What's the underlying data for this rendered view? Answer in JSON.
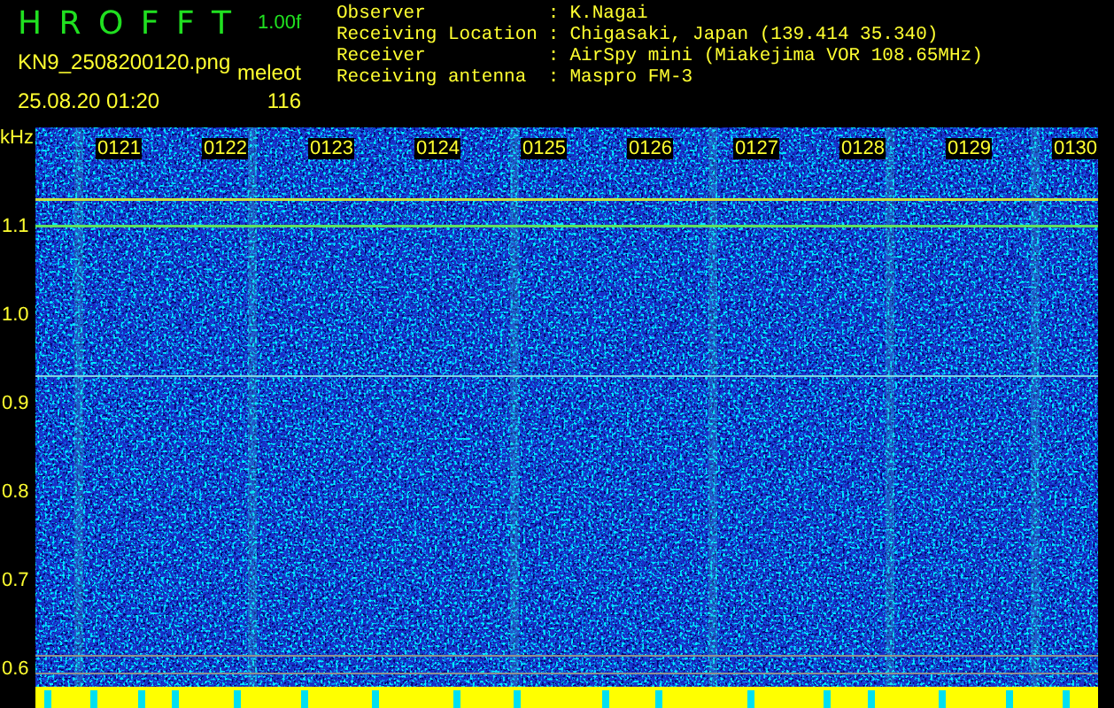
{
  "header": {
    "title": "H R O F F T",
    "scale": "1.00f",
    "filename": "KN9_2508200120.png",
    "count_label": "meleot",
    "datetime": "25.08.20 01:20",
    "count": "116"
  },
  "info": [
    {
      "label": "Observer",
      "sep": ":",
      "value": "K.Nagai"
    },
    {
      "label": "Receiving Location",
      "sep": ":",
      "value": "Chigasaki, Japan (139.414 35.340)"
    },
    {
      "label": "Receiver",
      "sep": ":",
      "value": "AirSpy mini (Miakejima VOR 108.65MHz)"
    },
    {
      "label": "Receiving antenna",
      "sep": ":",
      "value": "Maspro FM-3"
    }
  ],
  "y_axis": {
    "unit": "kHz",
    "labels": [
      "1.1",
      "1.0",
      "0.9",
      "0.8",
      "0.7",
      "0.6"
    ]
  },
  "time_labels": [
    "0121",
    "0122",
    "0123",
    "0124",
    "0125",
    "0126",
    "0127",
    "0128",
    "0129",
    "0130"
  ]
}
